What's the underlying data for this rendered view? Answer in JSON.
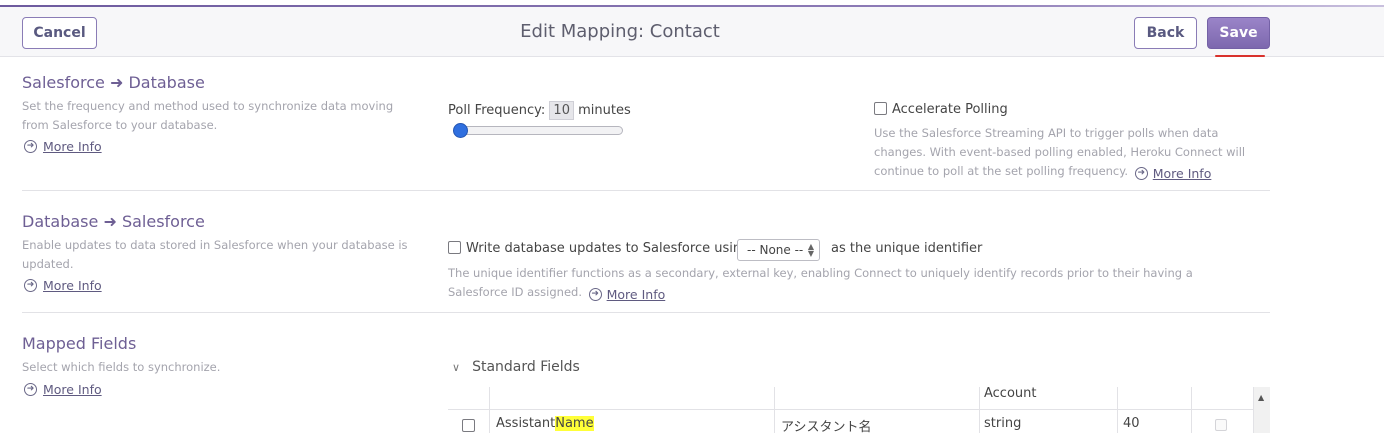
{
  "header": {
    "cancel_label": "Cancel",
    "title": "Edit Mapping: Contact",
    "back_label": "Back",
    "save_label": "Save"
  },
  "sections": {
    "sf_to_db": {
      "title_left": "Salesforce",
      "title_right": "Database",
      "description": "Set the frequency and method used to synchronize data moving from Salesforce to your database.",
      "more_info": "More Info",
      "poll_label": "Poll Frequency:",
      "poll_value": "10",
      "poll_unit": "minutes",
      "slider_fraction": 0.0,
      "accelerate_label": "Accelerate Polling",
      "accelerate_checked": false,
      "accelerate_desc": "Use the Salesforce Streaming API to trigger polls when data changes. With event-based polling enabled, Heroku Connect will continue to poll at the set polling frequency.",
      "accelerate_more": "More Info"
    },
    "db_to_sf": {
      "title_left": "Database",
      "title_right": "Salesforce",
      "description": "Enable updates to data stored in Salesforce when your database is updated.",
      "more_info": "More Info",
      "write_label": "Write database updates to Salesforce using",
      "write_checked": false,
      "select_value": "-- None --",
      "after_select": "as the unique identifier",
      "identifier_desc": "The unique identifier functions as a secondary, external key, enabling Connect to uniquely identify records prior to their having a Salesforce ID assigned.",
      "identifier_more": "More Info"
    },
    "mapped_fields": {
      "title": "Mapped Fields",
      "description": "Select which fields to synchronize.",
      "more_info": "More Info",
      "standard_fields_label": "Standard Fields",
      "header_cells": [
        "",
        "",
        "",
        "Account",
        "",
        ""
      ],
      "rows": [
        {
          "name_prefix": "Assistant",
          "name_highlight": "Name",
          "label": "アシスタント名",
          "type": "string",
          "length": "40"
        }
      ]
    }
  },
  "colors": {
    "accent": "#6e5f94",
    "save_button": "#8a74bb",
    "highlight": "#ffff38",
    "underline_marker": "#d9322d"
  }
}
